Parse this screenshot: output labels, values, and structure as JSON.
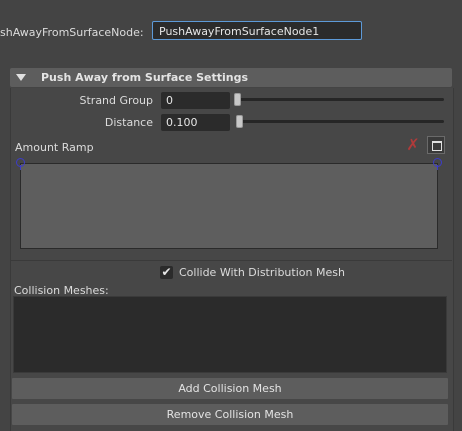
{
  "node": {
    "label": "shAwayFromSurfaceNode:",
    "value": "PushAwayFromSurfaceNode1"
  },
  "section": {
    "title": "Push Away from Surface Settings",
    "expanded": true
  },
  "fields": {
    "strand_group": {
      "label": "Strand Group",
      "value": "0"
    },
    "distance": {
      "label": "Distance",
      "value": "0.100"
    }
  },
  "ramp": {
    "label": "Amount Ramp"
  },
  "collide": {
    "label": "Collide With Distribution Mesh",
    "checked": true,
    "check_glyph": "✔"
  },
  "collision": {
    "label": "Collision Meshes:",
    "items": [],
    "add_label": "Add Collision Mesh",
    "remove_label": "Remove Collision Mesh"
  },
  "icons": {
    "delete": "✗"
  },
  "colors": {
    "background": "#444444",
    "field": "#2b2b2b",
    "focus_border": "#5d9ad8",
    "ramp_point": "#3c3cc8",
    "delete": "#b03a3a"
  }
}
